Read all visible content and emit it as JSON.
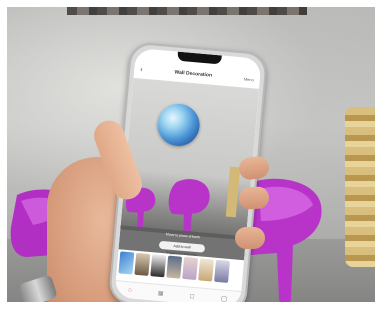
{
  "scene": {
    "description_colors": {
      "wall": "#c2c2c0",
      "chair": "#b834c9",
      "skin": "#dba585",
      "accent": "#e0583c"
    }
  },
  "phone_app": {
    "title": "Wall Decoration",
    "back_icon": "chevron-left-icon",
    "menu_label": "Menu",
    "panel_title": "Move to place artwork",
    "add_button_label": "Add to wall",
    "thumbnails_label": "Suggested artworks",
    "tabs": [
      {
        "icon": "home-icon",
        "glyph": "⌂",
        "active": true
      },
      {
        "icon": "grid-icon",
        "glyph": "▦",
        "active": false
      },
      {
        "icon": "bag-icon",
        "glyph": "◻",
        "active": false
      },
      {
        "icon": "user-icon",
        "glyph": "◯",
        "active": false
      }
    ]
  }
}
